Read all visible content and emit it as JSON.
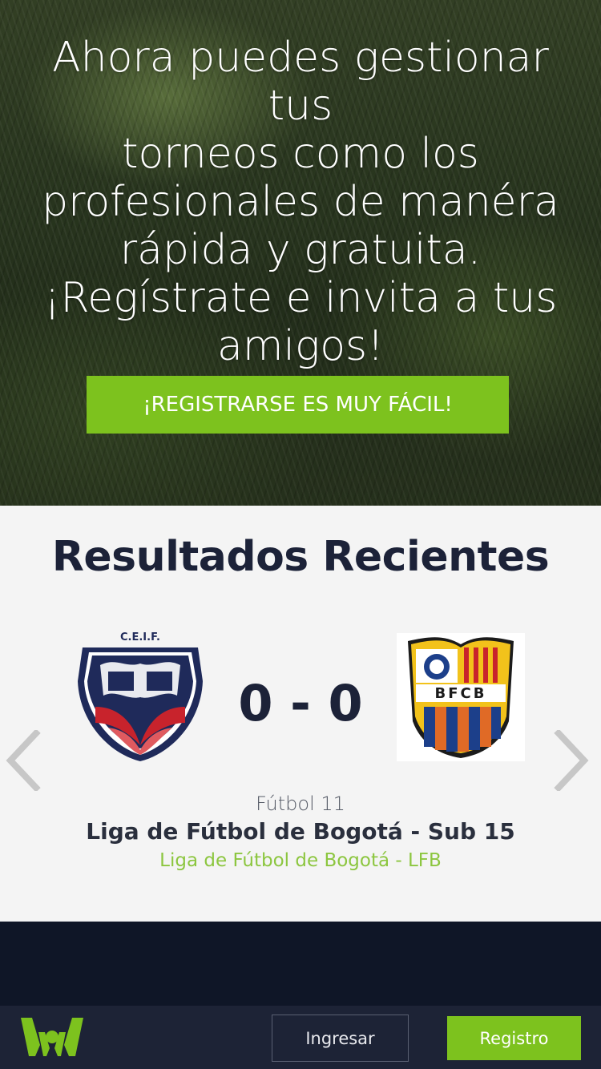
{
  "hero": {
    "lines": [
      "Ahora puedes gestionar tus",
      "torneos como los",
      "profesionales de manéra",
      "rápida y gratuita.",
      "¡Regístrate e invita a tus",
      "amigos!"
    ],
    "cta_label": "¡REGISTRARSE ES MUY FÁCIL!"
  },
  "results": {
    "title": "Resultados Recientes",
    "match": {
      "home_team_logo_text": "C.E.I.F.",
      "away_team_logo_text": "BFCB",
      "score": "0 - 0",
      "sport": "Fútbol 11",
      "league": "Liga de Fútbol de Bogotá - Sub 15",
      "organizer": "Liga de Fútbol de Bogotá - LFB"
    }
  },
  "footer": {
    "login_label": "Ingresar",
    "register_label": "Registro"
  },
  "colors": {
    "accent_green": "#7dc21e",
    "link_green": "#8cc63f",
    "navy_text": "#1c2238",
    "footer_bg": "#1d2336",
    "dark_band": "#0f1627"
  },
  "icons": [
    "chevron-left-icon",
    "chevron-right-icon",
    "brand-logo",
    "home-team-crest",
    "away-team-crest"
  ]
}
